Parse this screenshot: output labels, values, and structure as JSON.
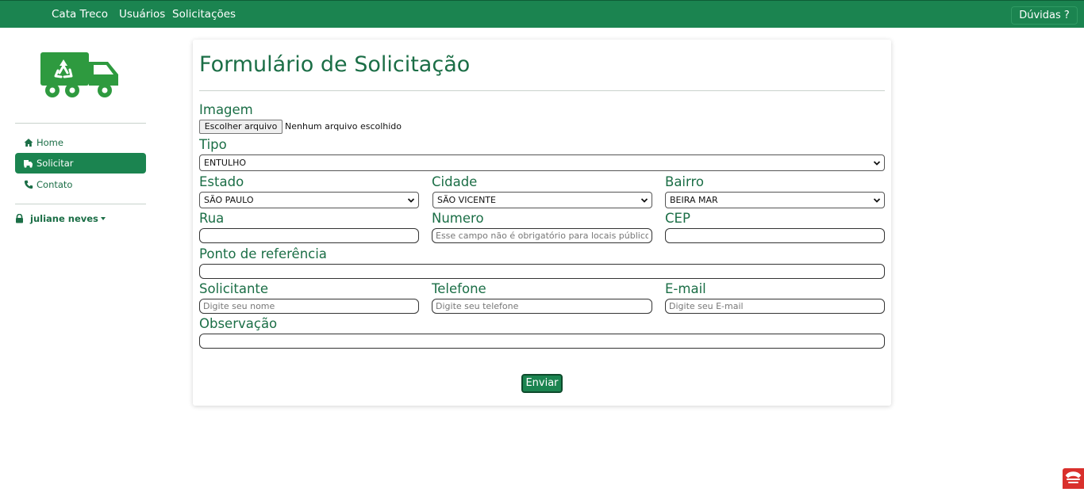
{
  "navbar": {
    "links": [
      "Cata Treco",
      "Usuários",
      "Solicitações"
    ],
    "help_label": "Dúvidas ?",
    "color": "#1b8450"
  },
  "sidebar": {
    "logo_icon": "recycling-truck-icon",
    "items": [
      {
        "label": "Home",
        "icon": "home-icon",
        "active": false
      },
      {
        "label": "Solicitar",
        "icon": "truck-icon",
        "active": true
      },
      {
        "label": "Contato",
        "icon": "phone-icon",
        "active": false
      }
    ],
    "user_name": "juliane neves"
  },
  "form": {
    "title": "Formulário de Solicitação",
    "imagem": {
      "label": "Imagem",
      "button": "Escolher arquivo",
      "status": "Nenhum arquivo escolhido"
    },
    "tipo": {
      "label": "Tipo",
      "value": "ENTULHO"
    },
    "estado": {
      "label": "Estado",
      "value": "SÃO PAULO"
    },
    "cidade": {
      "label": "Cidade",
      "value": "SÃO VICENTE"
    },
    "bairro": {
      "label": "Bairro",
      "value": "BEIRA MAR"
    },
    "rua": {
      "label": "Rua",
      "value": "",
      "placeholder": ""
    },
    "numero": {
      "label": "Numero",
      "value": "",
      "placeholder": "Esse campo não é obrigatório para locais públicos"
    },
    "cep": {
      "label": "CEP",
      "value": "",
      "placeholder": ""
    },
    "ponto_referencia": {
      "label": "Ponto de referência",
      "value": "",
      "placeholder": ""
    },
    "solicitante": {
      "label": "Solicitante",
      "value": "",
      "placeholder": "Digite seu nome"
    },
    "telefone": {
      "label": "Telefone",
      "value": "",
      "placeholder": "Digite seu telefone"
    },
    "email": {
      "label": "E-mail",
      "value": "",
      "placeholder": "Digite seu E-mail"
    },
    "observacao": {
      "label": "Observação",
      "value": "",
      "placeholder": ""
    },
    "submit_label": "Enviar"
  }
}
